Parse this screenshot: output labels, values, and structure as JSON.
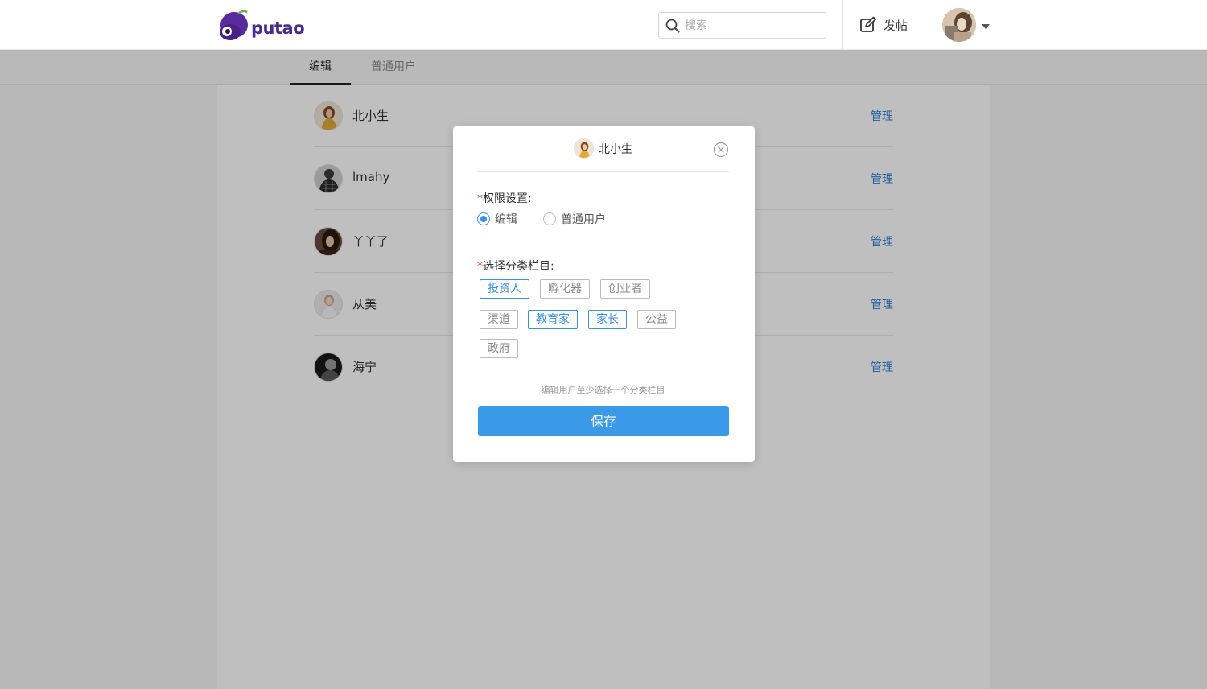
{
  "header": {
    "logo_text": "putao",
    "search": {
      "placeholder": "搜索",
      "value": ""
    },
    "post_label": "发帖",
    "colors": {
      "brand": "#4a2a8c",
      "accent": "#3a8ee6"
    }
  },
  "tabs": [
    {
      "label": "编辑",
      "active": true
    },
    {
      "label": "普通用户",
      "active": false
    }
  ],
  "users": [
    {
      "name": "北小生",
      "action": "管理"
    },
    {
      "name": "lmahy",
      "action": "管理"
    },
    {
      "name": "丫丫了",
      "action": "管理"
    },
    {
      "name": "从美",
      "action": "管理"
    },
    {
      "name": "海宁",
      "action": "管理"
    }
  ],
  "modal": {
    "user_name": "北小生",
    "permission_label": "权限设置:",
    "required_mark": "*",
    "roles": [
      {
        "label": "编辑",
        "checked": true
      },
      {
        "label": "普通用户",
        "checked": false
      }
    ],
    "category_label": "选择分类栏目:",
    "categories": [
      {
        "label": "投资人",
        "selected": true
      },
      {
        "label": "孵化器",
        "selected": false
      },
      {
        "label": "创业者",
        "selected": false
      },
      {
        "label": "渠道",
        "selected": false
      },
      {
        "label": "教育家",
        "selected": true
      },
      {
        "label": "家长",
        "selected": true
      },
      {
        "label": "公益",
        "selected": false
      },
      {
        "label": "政府",
        "selected": false
      }
    ],
    "hint": "编辑用户至少选择一个分类栏目",
    "save_label": "保存"
  }
}
